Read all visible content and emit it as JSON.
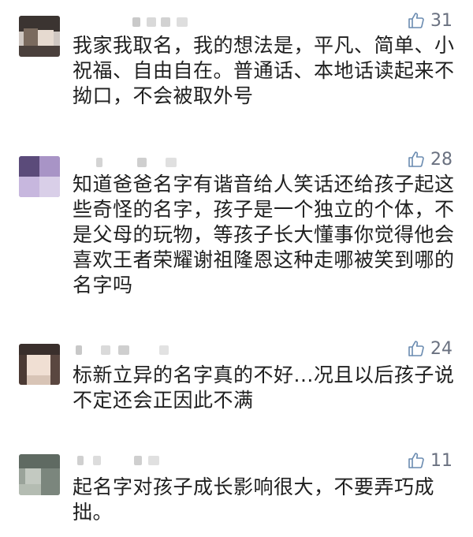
{
  "comments": [
    {
      "likes": "31",
      "text": "我家我取名，我的想法是，平凡、简单、小\n祝福、自由自在。普通话、本地话读起来不\n拗口，不会被取外号"
    },
    {
      "likes": "28",
      "text": "知道爸爸名字有谐音给人笑话还给孩子起这\n些奇怪的名字，孩子是一个独立的个体，不\n是父母的玩物，等孩子长大懂事你觉得他会\n喜欢王者荣耀谢祖隆恩这种走哪被笑到哪的\n名字吗"
    },
    {
      "likes": "24",
      "text": "标新立异的名字真的不好...况且以后孩子说\n不定还会正因此不满"
    },
    {
      "likes": "11",
      "text": "起名字对孩子成长影响很大，不要弄巧成\n拙。"
    }
  ],
  "colors": {
    "like_icon": "#6a8bb0",
    "like_count": "#6a7180",
    "text": "#1f1f1f"
  },
  "icons": {
    "like": "thumbs-up-outline-icon"
  }
}
